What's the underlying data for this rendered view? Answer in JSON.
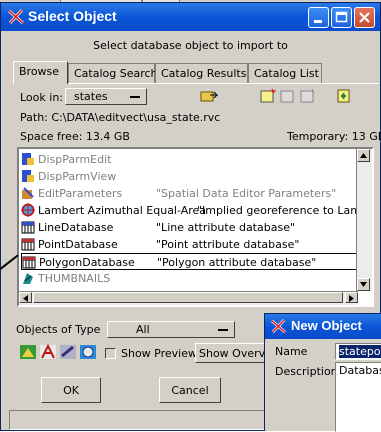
{
  "window": {
    "title": "Select Object",
    "subtitle": "Select database object to import to"
  },
  "tabs": [
    {
      "label": "Browse",
      "active": true
    },
    {
      "label": "Catalog Search",
      "active": false
    },
    {
      "label": "Catalog Results",
      "active": false
    },
    {
      "label": "Catalog List",
      "active": false
    }
  ],
  "look_in": {
    "label": "Look in:",
    "value": "states"
  },
  "path": "Path: C:\\DATA\\editvect\\usa_state.rvc",
  "space_free": "Space free:  13.4 GB",
  "temporary": "Temporary: 13 GB",
  "items": [
    {
      "name": "DispParmEdit",
      "desc": "",
      "icon": "parm-icon",
      "style": "gray"
    },
    {
      "name": "DispParmView",
      "desc": "",
      "icon": "parm-icon",
      "style": "gray"
    },
    {
      "name": "EditParameters",
      "desc": "\"Spatial Data Editor Parameters\"",
      "icon": "edit-params-icon",
      "style": "gray"
    },
    {
      "name": "Lambert Azimuthal Equal-Area",
      "desc": "\"Implied georeference to Lambert A",
      "icon": "georef-icon",
      "style": "gray"
    },
    {
      "name": "LineDatabase",
      "desc": "\"Line attribute database\"",
      "icon": "database-icon",
      "style": "normal"
    },
    {
      "name": "PointDatabase",
      "desc": "\"Point attribute database\"",
      "icon": "database-icon",
      "style": "normal"
    },
    {
      "name": "PolygonDatabase",
      "desc": "\"Polygon attribute database\"",
      "icon": "database-icon",
      "style": "selected"
    },
    {
      "name": "THUMBNAILS",
      "desc": "",
      "icon": "thumbnails-icon",
      "style": "gray"
    }
  ],
  "objects_of_type": {
    "label": "Objects of Type",
    "value": "All"
  },
  "show_preview": {
    "label": "Show Preview",
    "checked": false
  },
  "show_overview_label": "Show Overview",
  "ok_label": "OK",
  "cancel_label": "Cancel",
  "new_object": {
    "title": "New Object",
    "name_label": "Name",
    "name_value": "statepop",
    "description_label": "Description",
    "description_value": "Database"
  },
  "colors": {
    "title_bar": "#0b55d6",
    "selection_border": "#000000",
    "gray_text": "#808080"
  }
}
